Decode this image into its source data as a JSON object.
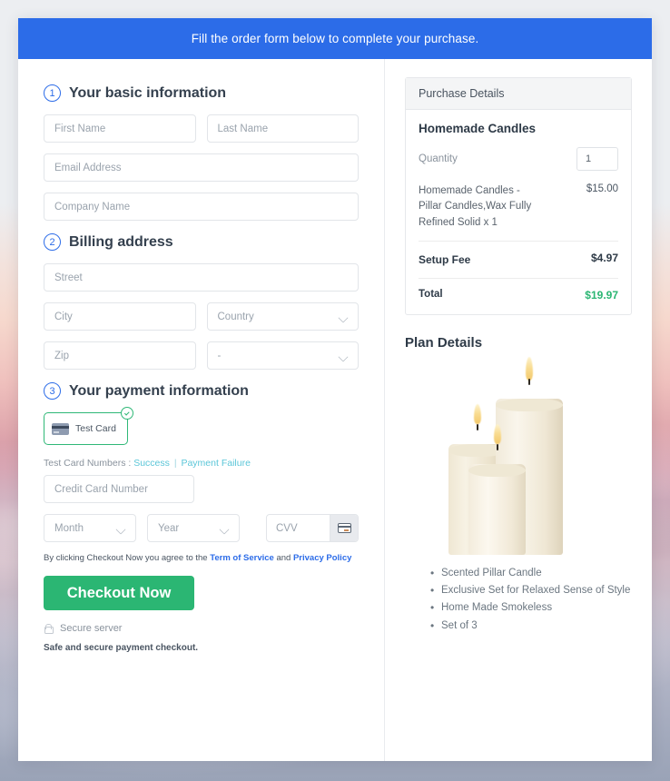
{
  "banner": {
    "text": "Fill the order form below to complete your purchase."
  },
  "steps": [
    {
      "num": "1",
      "title": "Your basic information"
    },
    {
      "num": "2",
      "title": "Billing address"
    },
    {
      "num": "3",
      "title": "Your payment information"
    }
  ],
  "basic_info": {
    "first_name_placeholder": "First Name",
    "last_name_placeholder": "Last Name",
    "email_placeholder": "Email Address",
    "company_placeholder": "Company Name"
  },
  "billing": {
    "street_placeholder": "Street",
    "city_placeholder": "City",
    "country_placeholder": "Country",
    "zip_placeholder": "Zip",
    "state_placeholder": "-"
  },
  "payment": {
    "test_card_label": "Test  Card",
    "card_icon": "credit-card-icon",
    "selected_check_icon": "check-circle-icon",
    "test_numbers_prefix": "Test Card Numbers :",
    "success_link": "Success",
    "separator": "|",
    "failure_link": "Payment Failure",
    "card_number_placeholder": "Credit Card Number",
    "month_placeholder": "Month",
    "year_placeholder": "Year",
    "cvv_placeholder": "CVV",
    "cvv_icon": "credit-card-icon"
  },
  "terms": {
    "prefix": "By clicking Checkout Now you agree to the",
    "tos_link": "Term of Service",
    "and": "and",
    "privacy_link": "Privacy Policy"
  },
  "checkout_button": {
    "label": "Checkout Now"
  },
  "secure": {
    "lock_icon": "lock-icon",
    "server_text": "Secure server",
    "note": "Safe and secure payment checkout."
  },
  "purchase": {
    "header": "Purchase Details",
    "product": "Homemade Candles",
    "quantity_label": "Quantity",
    "quantity_value": "1",
    "lines": [
      {
        "name": "Homemade Candles - Pillar Candles,Wax Fully Refined Solid x 1",
        "price": "$15.00",
        "bold": false
      },
      {
        "name": "Setup Fee",
        "price": "$4.97",
        "bold": true
      }
    ],
    "total_label": "Total",
    "total_value": "$19.97"
  },
  "plan": {
    "title": "Plan Details",
    "image_alt": "three-pillar-candles-image",
    "features": [
      "Scented Pillar Candle",
      "Exclusive Set for Relaxed Sense of Style",
      "Home Made Smokeless",
      "Set of 3"
    ]
  },
  "colors": {
    "banner_blue": "#2c6ce8",
    "accent_green": "#2bb673",
    "link_teal": "#5bc6d8",
    "link_blue": "#2c6ce8"
  }
}
